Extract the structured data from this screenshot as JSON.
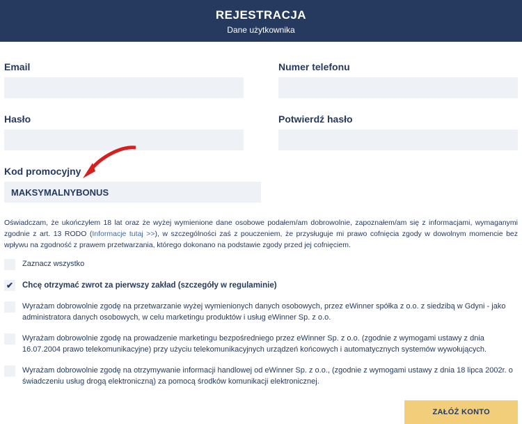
{
  "header": {
    "title": "REJESTRACJA",
    "subtitle": "Dane użytkownika"
  },
  "fields": {
    "email_label": "Email",
    "phone_label": "Numer telefonu",
    "password_label": "Hasło",
    "confirm_label": "Potwierdź hasło",
    "promo_label": "Kod promocyjny",
    "promo_value": "MAKSYMALNYBONUS"
  },
  "declaration": {
    "text_before": "Oświadczam, że ukończyłem 18 lat oraz że wyżej wymienione dane osobowe podałem/am dobrowolnie, zapoznałem/am się z informacjami, wymaganymi zgodnie z art. 13 RODO (",
    "link": "Informacje tutaj >>",
    "text_after": "), w szczególności zaś z pouczeniem, że przysługuje mi prawo cofnięcia zgody w dowolnym momencie bez wpływu na zgodność z prawem przetwarzania, którego dokonano na podstawie zgody przed jej cofnięciem."
  },
  "checks": {
    "select_all": "Zaznacz wszystko",
    "refund": "Chcę otrzymać zwrot za pierwszy zakład (szczegóły w regulaminie)",
    "consent1": "Wyrażam dobrowolnie zgodę na przetwarzanie wyżej wymienionych danych osobowych, przez eWinner spółka z o.o. z siedzibą w Gdyni - jako administratora danych osobowych, w celu marketingu produktów i usług eWinner Sp. z o.o.",
    "consent2": "Wyrażam dobrowolnie zgodę na prowadzenie marketingu bezpośredniego przez eWinner Sp. z o.o. (zgodnie z wymogami ustawy z dnia 16.07.2004 prawo telekomunikacyjne) przy użyciu telekomunikacyjnych urządzeń końcowych i automatycznych systemów wywołujących.",
    "consent3": "Wyrażam dobrowolnie zgodę na otrzymywanie informacji handlowej od eWinner Sp. z o.o., (zgodnie z wymogami ustawy z dnia 18 lipca 2002r. o świadczeniu usług drogą elektroniczną) za pomocą środków komunikacji elektronicznej."
  },
  "submit_label": "ZAŁÓŻ KONTO"
}
